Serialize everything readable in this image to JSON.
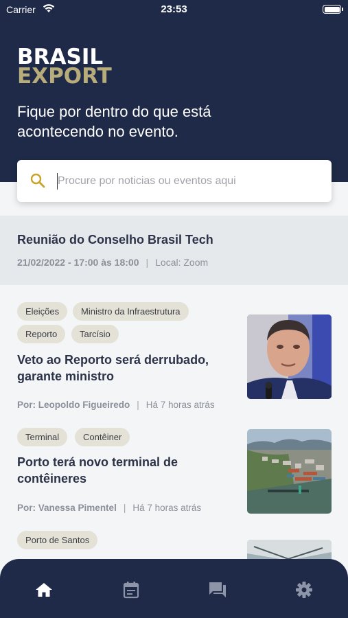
{
  "status_bar": {
    "carrier": "Carrier",
    "time": "23:53"
  },
  "brand": {
    "line1": "BRASIL",
    "line2": "EXPORT"
  },
  "tagline": "Fique por dentro do que está acontecendo no evento.",
  "search": {
    "placeholder": "Procure por noticias ou eventos aqui",
    "value": ""
  },
  "event": {
    "title": "Reunião do Conselho Brasil Tech",
    "datetime": "21/02/2022 - 17:00 às 18:00",
    "location": "Local: Zoom"
  },
  "news": [
    {
      "tags": [
        "Eleições",
        "Ministro da Infraestrutura",
        "Reporto",
        "Tarcísio"
      ],
      "title": "Veto ao Reporto será derrubado, garante ministro",
      "author": "Por: Leopoldo Figueiredo",
      "time": "Há 7 horas atrás",
      "image": "portrait-photo"
    },
    {
      "tags": [
        "Terminal",
        "Contêiner"
      ],
      "title": "Porto terá novo terminal de contêineres",
      "author": "Por: Vanessa Pimentel",
      "time": "Há 7 horas atrás",
      "image": "port-aerial-photo"
    },
    {
      "tags": [
        "Porto de Santos"
      ],
      "image": "building-photo"
    }
  ],
  "nav": [
    "home-icon",
    "calendar-icon",
    "chat-icon",
    "settings-icon"
  ],
  "colors": {
    "primary": "#1e2a47",
    "accent": "#b8ac7a",
    "tag_bg": "#e4e1d6",
    "search_icon": "#c9a227"
  }
}
